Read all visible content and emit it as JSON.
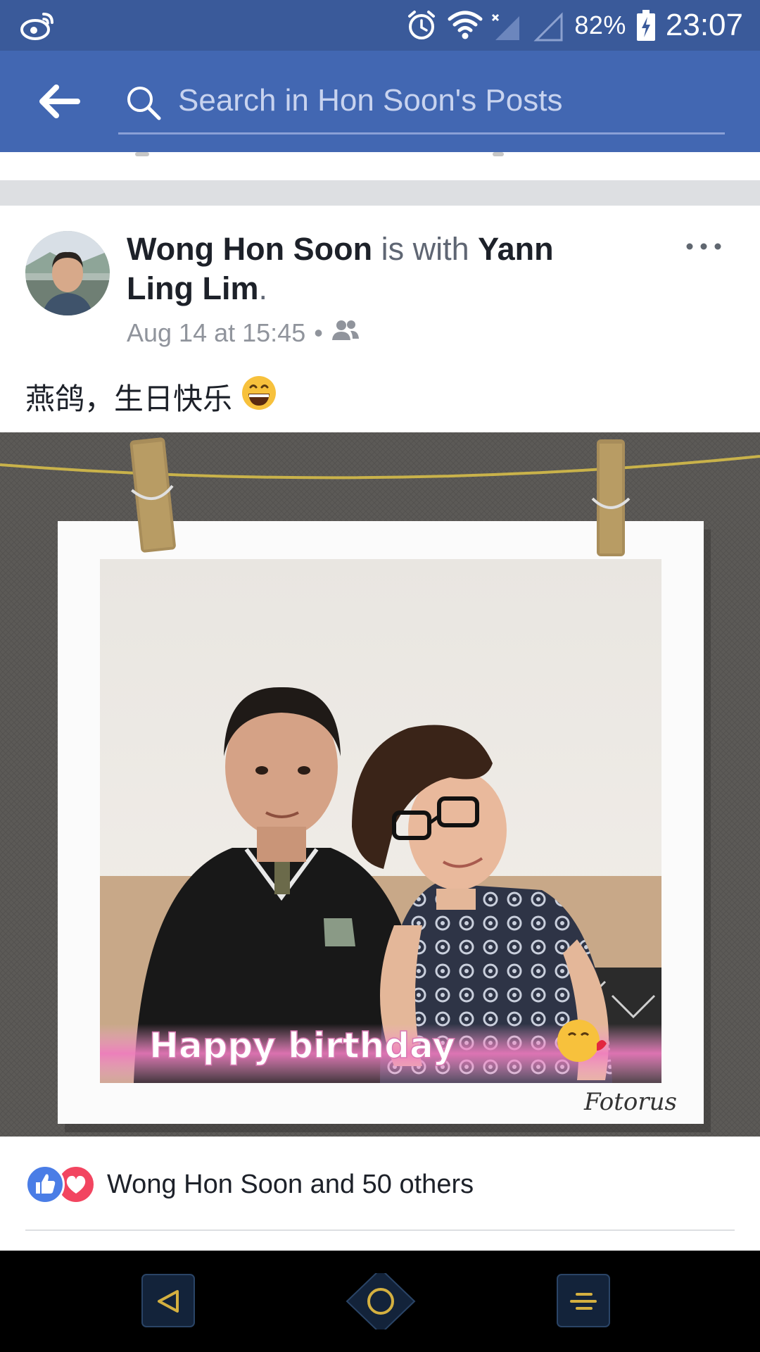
{
  "status_bar": {
    "battery": "82%",
    "time": "23:07",
    "icons": [
      "weibo-icon",
      "alarm-icon",
      "wifi-icon",
      "signal-off-icon",
      "signal-icon",
      "battery-charging-icon"
    ]
  },
  "search": {
    "placeholder": "Search in Hon Soon's Posts"
  },
  "post": {
    "author": "Wong Hon Soon",
    "with_text": " is with ",
    "tagged": "Yann Ling Lim",
    "period": ".",
    "timestamp": "Aug 14 at 15:45",
    "separator": "•",
    "audience_icon": "friends-icon",
    "text": "燕鸽，生日快乐",
    "emoji_icon": "grinning-face-icon",
    "photo": {
      "caption": "Happy birthday",
      "watermark": "Fotorus"
    },
    "reactions": {
      "summary": "Wong Hon Soon and 50 others",
      "icons": [
        "like-icon",
        "love-icon"
      ]
    }
  },
  "colors": {
    "status_bar": "#3a5a9a",
    "header": "#4267b2",
    "link_text": "#1d2129",
    "meta_text": "#90949c",
    "like_blue": "#4a7de6",
    "love_red": "#f24560"
  },
  "nav_bar": {
    "buttons": [
      "back",
      "home",
      "menu"
    ]
  }
}
